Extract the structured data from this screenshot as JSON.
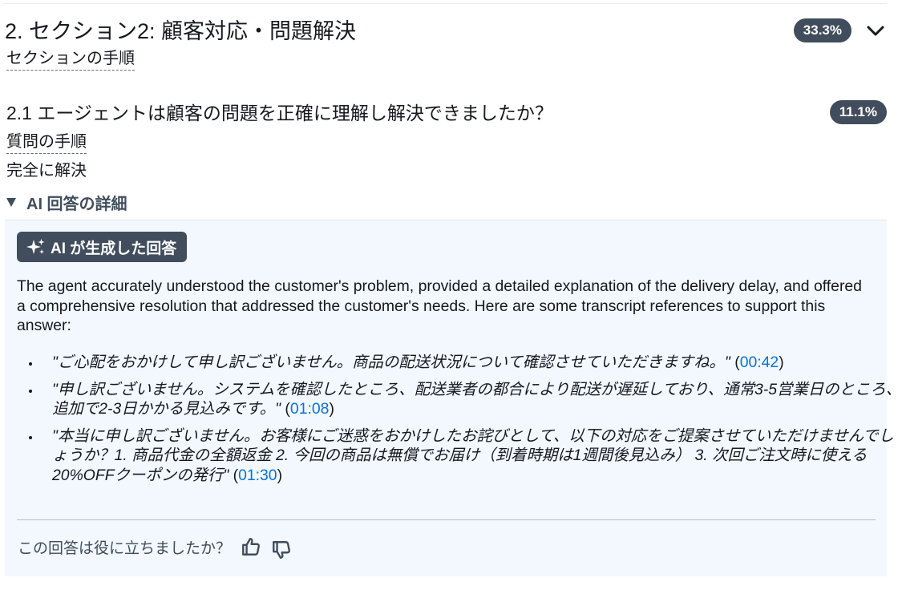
{
  "section": {
    "title": "2. セクション2: 顧客対応・問題解決",
    "percent": "33.3%",
    "steps_link": "セクションの手順"
  },
  "question": {
    "title": "2.1 エージェントは顧客の問題を正確に理解し解決できましたか？",
    "percent": "11.1%",
    "steps_link": "質問の手順",
    "answer": "完全に解決"
  },
  "ai_details": {
    "toggle_label": "AI 回答の詳細",
    "chip_label": "AI が生成した回答",
    "summary": "The agent accurately understood the customer's problem, provided a detailed explanation of the delivery delay, and offered a comprehensive resolution that addressed the customer's needs. Here are some transcript references to support this answer:",
    "references": [
      {
        "quote": "\"ご心配をおかけして申し訳ございません。商品の配送状況について確認させていただきますね。\"",
        "timestamp": "00:42"
      },
      {
        "quote": "\"申し訳ございません。システムを確認したところ、配送業者の都合により配送が遅延しており、通常3-5営業日のところ、追加で2-3日かかる見込みです。\"",
        "timestamp": "01:08"
      },
      {
        "quote": "\"本当に申し訳ございません。お客様にご迷惑をおかけしたお詫びとして、以下の対応をご提案させていただけませんでしょうか？1. 商品代金の全額返金 2. 今回の商品は無償でお届け（到着時期は1週間後見込み） 3. 次回ご注文時に使える20%OFFクーポンの発行\"",
        "timestamp": "01:30"
      }
    ],
    "feedback_prompt": "この回答は役に立ちましたか？"
  },
  "icons": {
    "collapse": "chevron-down-icon",
    "ai": "sparkle-icon",
    "like": "thumbs-up-icon",
    "dislike": "thumbs-down-icon"
  },
  "colors": {
    "badge_bg": "#414d5c",
    "panel_bg": "#f2f8fd",
    "link": "#0972d3"
  }
}
